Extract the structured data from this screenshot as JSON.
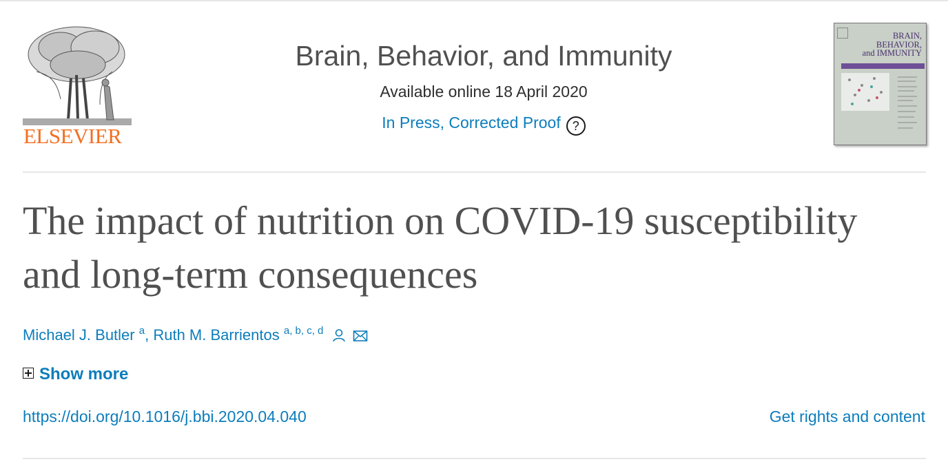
{
  "header": {
    "publisher": "ELSEVIER",
    "journal_title": "Brain, Behavior, and Immunity",
    "availability": "Available online 18 April 2020",
    "status_link": "In Press, Corrected Proof",
    "help_symbol": "?"
  },
  "cover": {
    "line1": "BRAIN,",
    "line2": "BEHAVIOR,",
    "line3": "and IMMUNITY"
  },
  "article": {
    "title": "The impact of nutrition on COVID-19 susceptibility and long-term consequences",
    "authors": [
      {
        "name": "Michael J. Butler",
        "affiliations": "a"
      },
      {
        "name": "Ruth M. Barrientos",
        "affiliations": "a, b, c, d"
      }
    ],
    "author_separator": ", ",
    "show_more": "Show more",
    "doi": "https://doi.org/10.1016/j.bbi.2020.04.040",
    "rights": "Get rights and content"
  },
  "colors": {
    "link": "#0c7dbb",
    "publisher_orange": "#f36f21",
    "title_gray": "#505050",
    "cover_purple": "#6e4e97"
  }
}
